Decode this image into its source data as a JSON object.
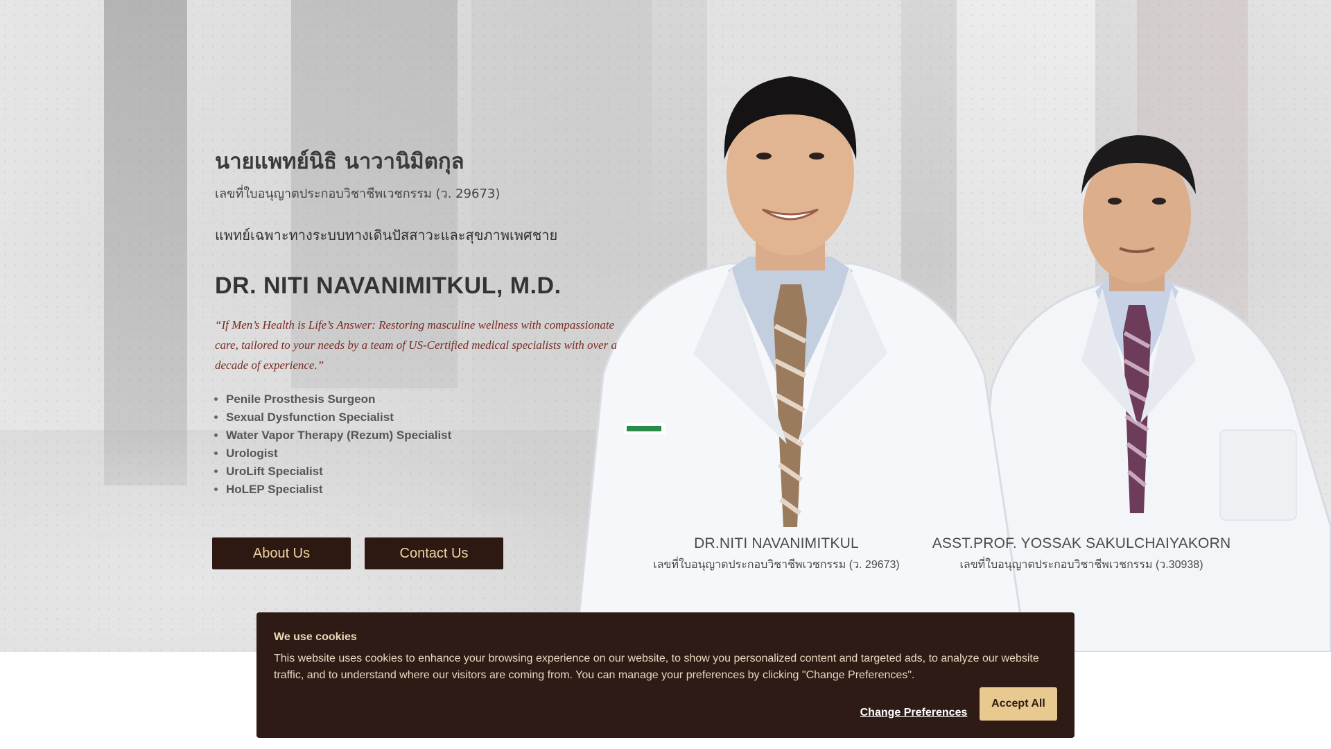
{
  "hero": {
    "thai_name": "นายแพทย์นิธิ นาวานิมิตกุล",
    "license": "เลขที่ใบอนุญาตประกอบวิชาชีพเวชกรรม (ว. 29673)",
    "specialty_thai": "แพทย์เฉพาะทางระบบทางเดินปัสสาวะและสุขภาพเพศชาย",
    "english_name": "DR. NITI NAVANIMITKUL, M.D.",
    "quote": "“If Men’s Health is Life’s Answer: Restoring masculine wellness with compassionate care, tailored to your needs by a team of US-Certified medical specialists with over a decade of experience.”",
    "credentials": [
      "Penile Prosthesis Surgeon",
      "Sexual Dysfunction Specialist",
      "Water Vapor Therapy (Rezum) Specialist",
      "Urologist",
      "UroLift Specialist",
      "HoLEP Specialist"
    ],
    "about_button": "About Us",
    "contact_button": "Contact Us"
  },
  "doctors": [
    {
      "name": "DR.NITI NAVANIMITKUL",
      "license": "เลขที่ใบอนุญาตประกอบวิชาชีพเวชกรรม (ว. 29673)"
    },
    {
      "name": "ASST.PROF. YOSSAK SAKULCHAIYAKORN",
      "license": "เลขที่ใบอนุญาตประกอบวิชาชีพเวชกรรม (ว.30938)"
    }
  ],
  "cookie": {
    "title": "We use cookies",
    "text": "This website uses cookies to enhance your browsing experience on our website, to show you personalized content and targeted ads, to analyze our website traffic, and to understand where our visitors are coming from. You can manage your preferences by clicking \"Change Preferences\".",
    "change_label": "Change Preferences",
    "accept_label": "Accept All"
  },
  "colors": {
    "button_bg": "#2e1812",
    "button_text": "#f1d7a4",
    "quote": "#7a2a22",
    "cookie_bg": "#2e1b15",
    "accept_bg": "#e8c98f"
  }
}
